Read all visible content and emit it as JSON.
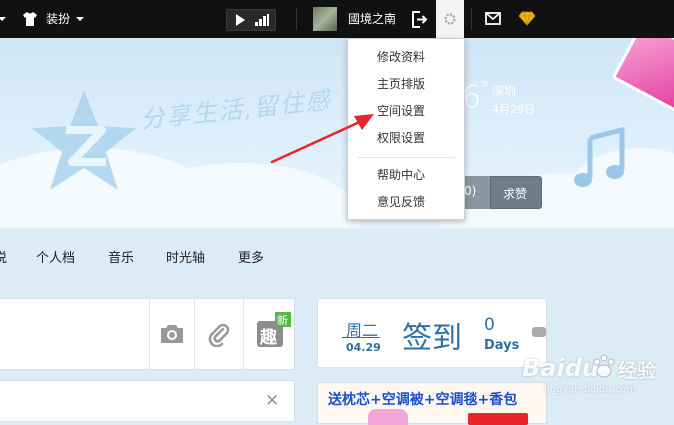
{
  "topbar": {
    "dress_label": "装扮",
    "user_name": "國境之南"
  },
  "banner": {
    "slogan": "分享生活,留住感",
    "weather_temp_digit": "6",
    "weather_degree": "°",
    "city": "深圳",
    "date": "4月29日",
    "praise_label": "求赞",
    "praise_count": "0)"
  },
  "nav": {
    "items": [
      {
        "label": "说"
      },
      {
        "label": "个人档"
      },
      {
        "label": "音乐"
      },
      {
        "label": "时光轴"
      },
      {
        "label": "更多"
      }
    ]
  },
  "composer": {
    "fun_icon_label": "趣",
    "new_badge": "新"
  },
  "checkin": {
    "weekday": "周二",
    "date": "04.29",
    "label": "签到",
    "days_count": "0",
    "days_label": "Days"
  },
  "ad": {
    "text": "送枕芯+空调被+空调毯+香包"
  },
  "dropdown": {
    "items": [
      {
        "label": "修改资料"
      },
      {
        "label": "主页排版"
      },
      {
        "label": "空间设置"
      },
      {
        "label": "权限设置"
      },
      {
        "label": "帮助中心"
      },
      {
        "label": "意见反馈"
      }
    ]
  },
  "watermark": {
    "brand": "Baidu",
    "suffix": "经验",
    "url": "jingyan.baidu.com"
  },
  "colors": {
    "topbar_bg": "#111111",
    "annotation_arrow": "#e8262a",
    "checkin_blue": "#2f6fa7",
    "ad_text_blue": "#1a4fd0",
    "vip_gold": "#f4b51c"
  }
}
